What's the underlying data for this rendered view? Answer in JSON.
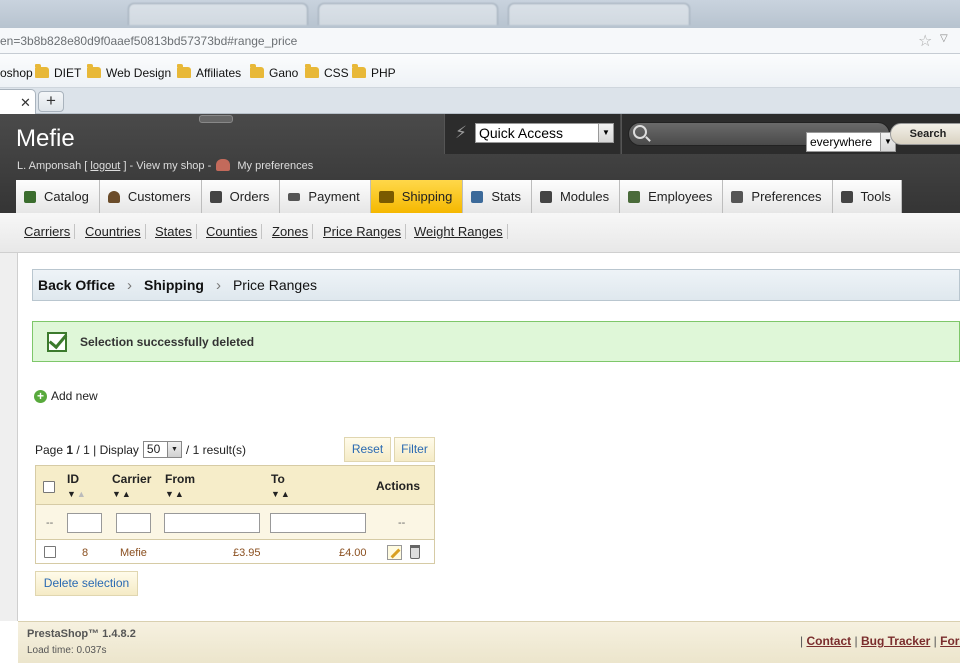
{
  "browser": {
    "url": "en=3b8b828e80d9f0aaef50813bd57373bd#range_price",
    "bookmarks": [
      "oshop",
      "DIET",
      "Web Design",
      "Affiliates",
      "Gano",
      "CSS",
      "PHP"
    ]
  },
  "header": {
    "shop_name": "Mefie",
    "user_name": "L. Amponsah [",
    "logout": "logout",
    "user_suffix": "] - View my shop -",
    "preferences": "My preferences",
    "quick_access": "Quick Access",
    "search_scope": "everywhere",
    "search_button": "Search"
  },
  "nav": [
    {
      "label": "Catalog",
      "color": "#3b6d2e"
    },
    {
      "label": "Customers",
      "color": "#6b4c2a"
    },
    {
      "label": "Orders",
      "color": "#444444"
    },
    {
      "label": "Payment",
      "color": "#555555"
    },
    {
      "label": "Shipping",
      "color": "#7a5a00"
    },
    {
      "label": "Stats",
      "color": "#3c6a9a"
    },
    {
      "label": "Modules",
      "color": "#444444"
    },
    {
      "label": "Employees",
      "color": "#4a6b3a"
    },
    {
      "label": "Preferences",
      "color": "#555555"
    },
    {
      "label": "Tools",
      "color": "#444444"
    }
  ],
  "subnav": [
    "Carriers",
    "Countries",
    "States",
    "Counties",
    "Zones",
    "Price Ranges",
    "Weight Ranges"
  ],
  "breadcrumb": {
    "root": "Back Office",
    "section": "Shipping",
    "page": "Price Ranges"
  },
  "confirmation": "Selection successfully deleted",
  "add_new": "Add new",
  "pager": {
    "page_word": "Page",
    "page": "1",
    "slash": "/",
    "total_pages": "1",
    "display_word": "| Display",
    "per_page": "50",
    "results": "/ 1 result(s)"
  },
  "buttons": {
    "reset": "Reset",
    "filter": "Filter",
    "delete_selection": "Delete selection"
  },
  "table": {
    "headers": {
      "id": "ID",
      "carrier": "Carrier",
      "from": "From",
      "to": "To",
      "actions": "Actions"
    },
    "filter_dash": "--",
    "rows": [
      {
        "id": "8",
        "carrier": "Mefie",
        "from": "£3.95",
        "to": "£4.00"
      }
    ]
  },
  "footer": {
    "brand": "PrestaShop™ 1.4.8.2",
    "load_time": "Load time: 0.037s",
    "sep": "|",
    "links": [
      "Contact",
      "Bug Tracker",
      "Forum"
    ]
  }
}
